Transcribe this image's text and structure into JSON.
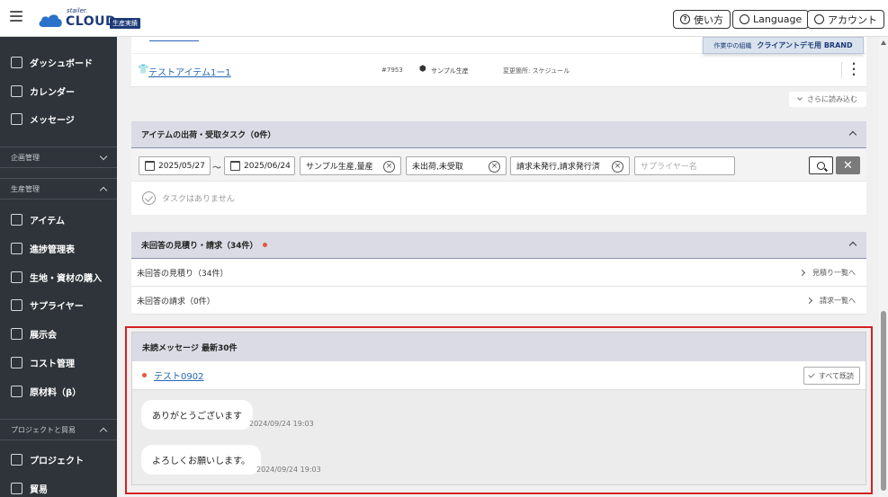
{
  "header": {
    "logo_small": "stailer.",
    "logo_main": "CLOUD",
    "logo_badge": "生産実績",
    "help_label": "使い方",
    "language_label": "Language",
    "account_label": "アカウント",
    "org_prefix": "作業中の組織",
    "org_name": "クライアントデモ用 BRAND"
  },
  "sidebar": {
    "top_items": [
      {
        "label": "ダッシュボード",
        "icon": "dashboard-icon"
      },
      {
        "label": "カレンダー",
        "icon": "calendar-icon"
      },
      {
        "label": "メッセージ",
        "icon": "message-icon"
      }
    ],
    "section_plan": "企画管理",
    "section_production": "生産管理",
    "production_items": [
      {
        "label": "アイテム",
        "icon": "list-icon"
      },
      {
        "label": "進捗管理表",
        "icon": "grid-icon"
      },
      {
        "label": "生地・資材の購入",
        "icon": "fabric-icon"
      },
      {
        "label": "サプライヤー",
        "icon": "building-icon"
      },
      {
        "label": "展示会",
        "icon": "person-icon"
      },
      {
        "label": "コスト管理",
        "icon": "calculator-icon"
      },
      {
        "label": "原材料（β）",
        "icon": "material-icon"
      }
    ],
    "section_project": "プロジェクトと貿易",
    "project_items": [
      {
        "label": "プロジェクト",
        "icon": "thumbs-up-icon"
      },
      {
        "label": "貿易",
        "icon": "trade-icon"
      }
    ]
  },
  "item_row": {
    "name": "テストアイテム1ー1",
    "number": "#7953",
    "production": "サンプル生産",
    "change": "変更箇所: スケジュール"
  },
  "load_more": "さらに読み込む",
  "shipping_panel": {
    "title": "アイテムの出荷・受取タスク（0件）",
    "date_from": "2025/05/27",
    "tilde": "〜",
    "date_to": "2025/06/24",
    "filter_production": "サンプル生産,量産",
    "filter_status": "未出荷,未受取",
    "filter_billing": "請求未発行,請求発行済",
    "supplier_placeholder": "サプライヤー名",
    "empty": "タスクはありません"
  },
  "unanswered_panel": {
    "title": "未回答の見積り・請求（34件）",
    "row1_label": "未回答の見積り（34件）",
    "row1_link": "見積り一覧へ",
    "row2_label": "未回答の請求（0件）",
    "row2_link": "請求一覧へ"
  },
  "messages_panel": {
    "title": "未読メッセージ 最新30件",
    "thread": "テスト0902",
    "mark_all_read": "すべて既読",
    "messages": [
      {
        "text": "ありがとうございます",
        "time": "2024/09/24 19:03"
      },
      {
        "text": "よろしくお願いします。",
        "time": "2024/09/24 19:03"
      }
    ]
  }
}
